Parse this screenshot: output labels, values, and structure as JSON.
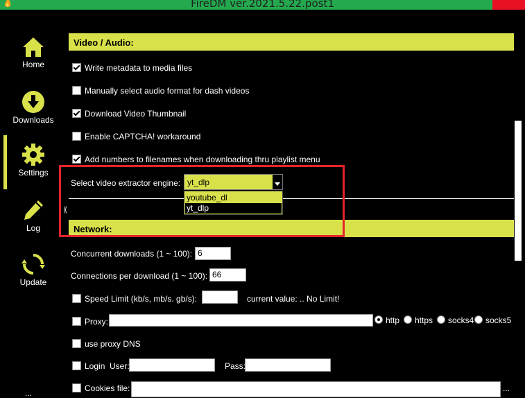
{
  "window": {
    "title": "FireDM ver.2021.5.22.post1"
  },
  "sidebar": {
    "items": [
      {
        "label": "Home",
        "icon": "home-icon"
      },
      {
        "label": "Downloads",
        "icon": "download-icon"
      },
      {
        "label": "Settings",
        "icon": "gear-icon"
      },
      {
        "label": "Log",
        "icon": "pencil-icon"
      },
      {
        "label": "Update",
        "icon": "refresh-icon"
      }
    ],
    "selected": "Settings",
    "more": "..."
  },
  "video_audio": {
    "header": "Video / Audio:",
    "options": [
      {
        "label": "Write metadata to media files",
        "checked": true
      },
      {
        "label": "Manually select audio format for dash videos",
        "checked": false
      },
      {
        "label": "Download Video Thumbnail",
        "checked": true
      },
      {
        "label": "Enable CAPTCHA! workaround",
        "checked": false
      },
      {
        "label": "Add numbers to filenames when downloading thru playlist menu",
        "checked": true
      }
    ],
    "extractor": {
      "label": "Select video extractor engine:",
      "value": "yt_dlp",
      "options": [
        "youtube_dl",
        "yt_dlp"
      ]
    }
  },
  "network": {
    "header": "Network:",
    "concurrent_label": "Concurrent downloads (1 ~ 100):",
    "concurrent_value": "6",
    "connections_label": "Connections per download (1 ~ 100):",
    "connections_value": "66",
    "speed_limit_label": "Speed Limit (kb/s, mb/s. gb/s):",
    "speed_limit_value": "",
    "current_value_text": "current value: .. No Limit!",
    "proxy_label": "Proxy:",
    "proxy_value": "",
    "proxy_types": [
      "http",
      "https",
      "socks4",
      "socks5"
    ],
    "proxy_selected": "http",
    "proxy_dns_label": "use proxy DNS",
    "login_label": "Login",
    "user_label": "User:",
    "pass_label": "Pass:",
    "cookies_label": "Cookies file:",
    "cookies_browse": "..."
  },
  "colors": {
    "accent": "#d9e14a",
    "titlebar": "#24a94f",
    "close": "#e81123",
    "highlight": "#e5232a"
  }
}
